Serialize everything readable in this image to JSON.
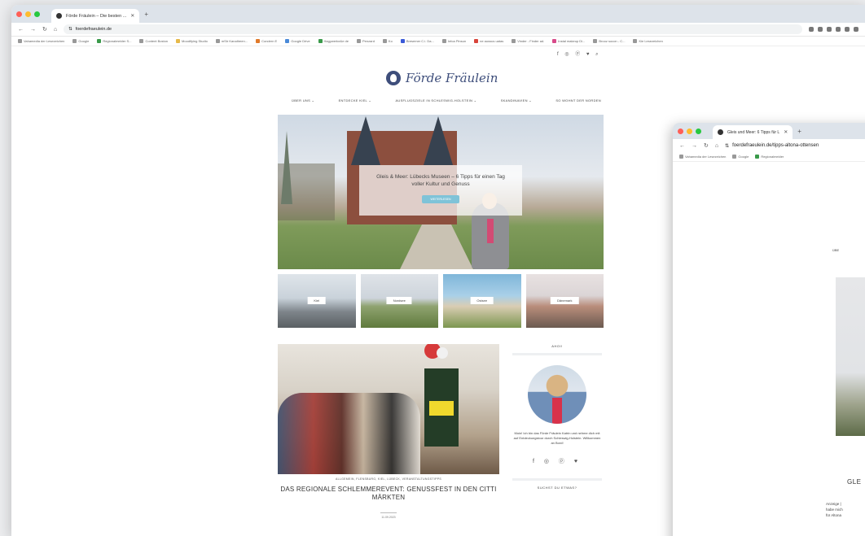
{
  "main_window": {
    "tab_title": "Förde Fräulein – Die besten ...",
    "url": "foerdefraeulein.de",
    "bookmarks": [
      "Vahamedia der Lesezeichen",
      "Google",
      "Regionalmelder S...",
      "Content Boston",
      "Moodifying Studio",
      "mStr Kanaltreen...",
      "Condern E",
      "Google Drive",
      "Hagywerke&e de",
      "Penzard",
      "Ko",
      "Bresemer C.i. Da...",
      "Infoa Pinsun",
      "ne aussus uatas",
      "Vinder - Finder ad.",
      "Instal makeup Di...",
      "Brooz socon - C...",
      "Kie Lesezeichen"
    ],
    "site": {
      "social_icons": "f ◎ ⓟ ♥ ⌕",
      "logo_text": "Förde Fräulein",
      "menu": [
        "ÜBER UNS ⌄",
        "ENTDECKE KIEL ⌄",
        "AUSFLUGSZIELE IN SCHLESWIG-HOLSTEIN ⌄",
        "SKANDINAVIEN ⌄",
        "SO WOHNT DER NORDEN"
      ],
      "hero": {
        "title": "Gleis & Meer: Lübecks Museen – 6 Tipps für einen Tag voller Kultur und Genuss",
        "button": "WEITERLESEN"
      },
      "categories": [
        "Kiel",
        "Nordsee",
        "Ostsee",
        "Dänemark"
      ],
      "post": {
        "meta": "ALLGEMEIN, FLENSBURG, KIEL, LÜBECK, VERANSTALTUNGSTIPPS",
        "title": "DAS REGIONALE SCHLEMMEREVENT: GENUSSFEST IN DEN CITTI MÄRKTEN",
        "date": "11.09.2023"
      },
      "sidebar": {
        "heading": "AHOI!",
        "text": "Moin! Ich bin das Förde Fräulein Katrin und nehme dich mit auf Entdeckungstour durch Schleswig-Holstein. Willkommen an Bord!",
        "social": "f ◎ ⓟ ♥",
        "search_heading": "SUCHST DU ETWAS?"
      }
    }
  },
  "second_window": {
    "tab_title": "Gleis und Meer: 6 Tipps für L",
    "url": "foerdefraeulein.de/tipps-altona-ottensen",
    "bookmarks": [
      "Vahamedia der Lesezeichen",
      "Google",
      "Regionalmelder"
    ],
    "menu_partial": "ÜBE",
    "title_partial": "GLE",
    "text_partial": "Anzeige | \nhabe mich \nfür Altona"
  },
  "colors": {
    "logo_blue": "#3e4e7b",
    "traffic_red": "#ff5f57",
    "traffic_yellow": "#febc2e",
    "traffic_green": "#28c840",
    "hero_button": "#7fc3d8"
  }
}
